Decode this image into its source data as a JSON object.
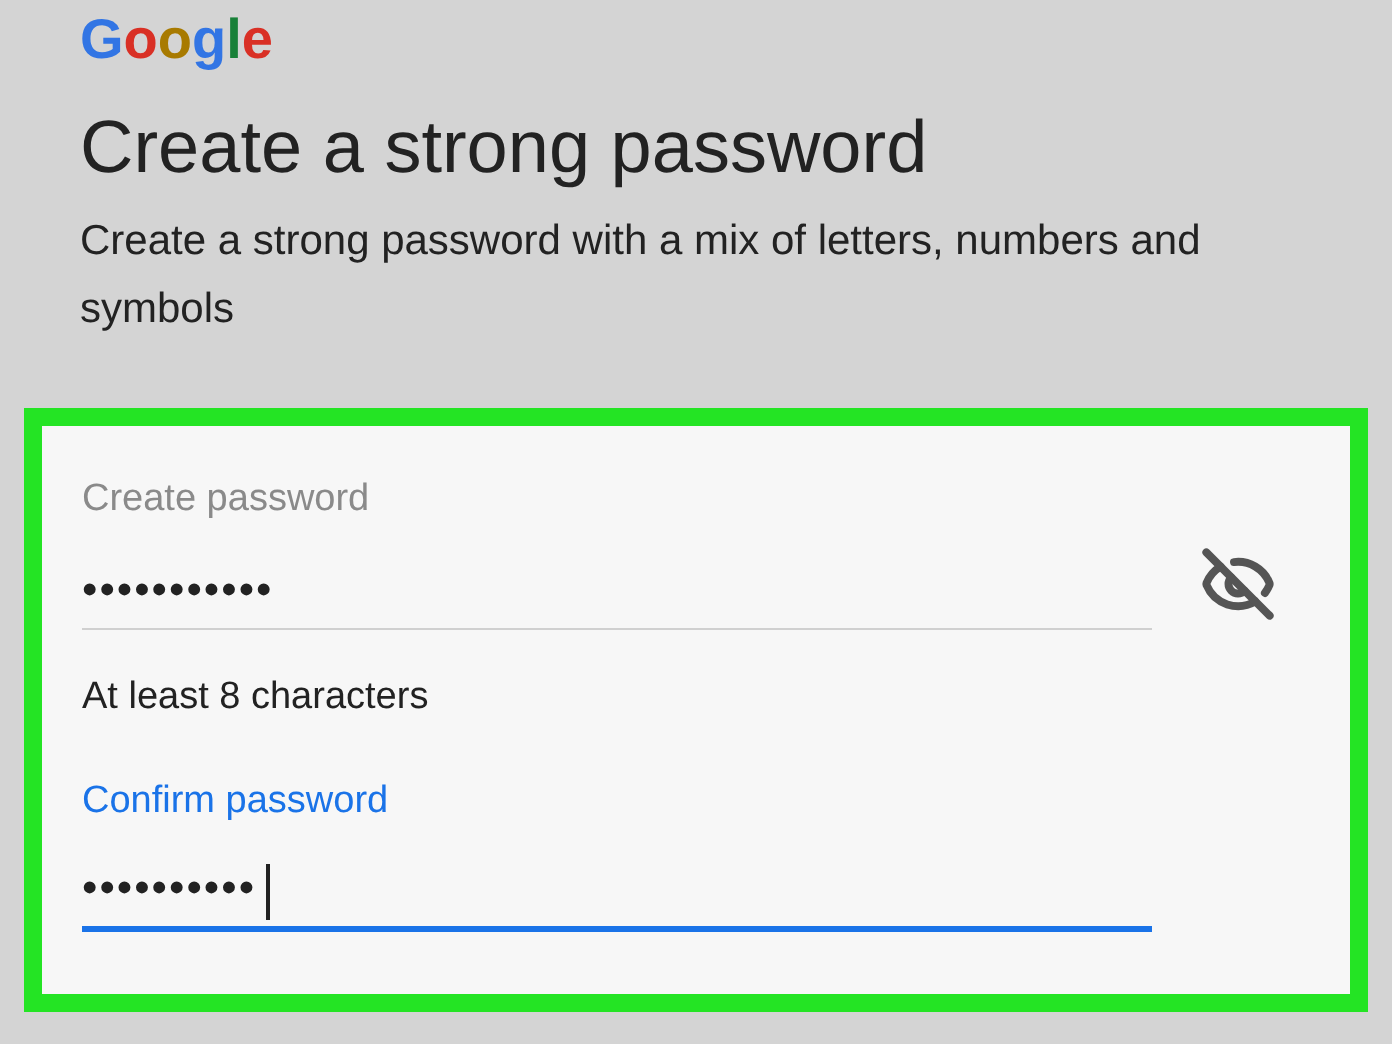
{
  "logo": "Google",
  "title": "Create a strong password",
  "subtitle": "Create a strong password with a mix of letters, numbers and symbols",
  "fields": [
    {
      "label": "Create password",
      "value": "•••••••••••",
      "focused": false
    },
    {
      "label": "Confirm password",
      "value": "••••••••••",
      "focused": true
    }
  ],
  "visibility_toggle": {
    "password_visible": false
  },
  "hint": "At least 8 characters"
}
